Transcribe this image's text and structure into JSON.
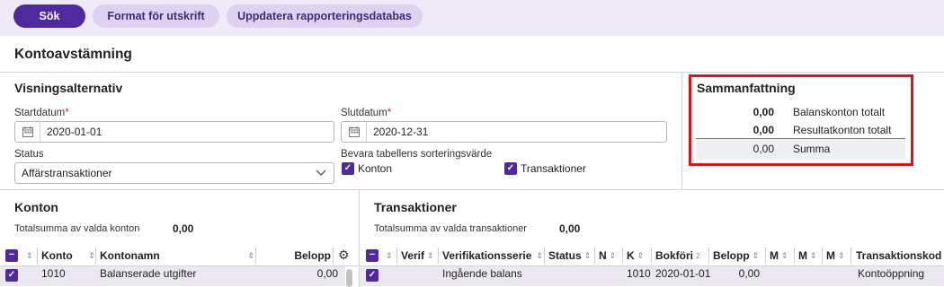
{
  "toolbar": {
    "search_label": "Sök",
    "print_label": "Format för utskrift",
    "update_label": "Uppdatera rapporteringsdatabas"
  },
  "page_title": "Kontoavstämning",
  "options": {
    "title": "Visningsalternativ",
    "start_label": "Startdatum",
    "start_value": "2020-01-01",
    "end_label": "Slutdatum",
    "end_value": "2020-12-31",
    "required_mark": "*",
    "status_label": "Status",
    "status_value": "Affärstransaktioner",
    "keep_sort_label": "Bevara tabellens sorteringsvärde",
    "keep_accounts_label": "Konton",
    "keep_transactions_label": "Transaktioner"
  },
  "summary": {
    "title": "Sammanfattning",
    "balance_value": "0,00",
    "balance_label": "Balanskonton totalt",
    "result_value": "0,00",
    "result_label": "Resultatkonton totalt",
    "sum_value": "0,00",
    "sum_label": "Summa"
  },
  "accounts": {
    "title": "Konton",
    "total_label": "Totalsumma av valda konton",
    "total_value": "0,00",
    "columns": [
      "Konto",
      "Kontonamn",
      "Belopp"
    ],
    "rows": [
      {
        "konto": "1010",
        "kontonamn": "Balanserade utgifter",
        "belopp": "0,00"
      }
    ]
  },
  "transactions": {
    "title": "Transaktioner",
    "total_label": "Totalsumma av valda transaktioner",
    "total_value": "0,00",
    "columns": [
      "Verif",
      "Verifikationsserie",
      "Status",
      "N",
      "K",
      "Bokföri",
      "Belopp",
      "M",
      "M",
      "M",
      "Transaktionskod"
    ],
    "sort_badge": "2",
    "rows": [
      {
        "serie": "Ingående balans",
        "k": "1010",
        "date": "2020-01-01",
        "belopp": "0,00",
        "kod": "Kontoöppning"
      }
    ]
  },
  "icons": {
    "calendar": "calendar-icon",
    "chevron": "chevron-down-icon",
    "gear": "gear-icon",
    "check": "checkmark-icon"
  },
  "colors": {
    "accent": "#4e2a9e",
    "highlight": "#e0101a"
  }
}
